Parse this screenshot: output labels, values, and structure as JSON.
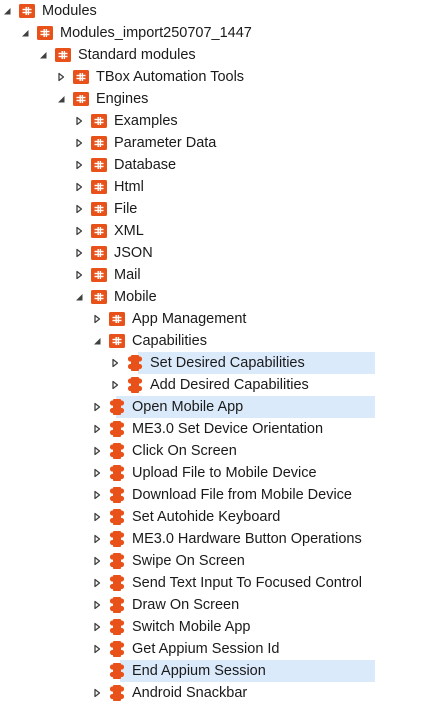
{
  "tree": {
    "root": {
      "label": "Modules",
      "toggle": "expanded",
      "icon": "folder-module-icon"
    },
    "import_folder": {
      "label": "Modules_import250707_1447",
      "toggle": "expanded",
      "icon": "folder-module-icon"
    },
    "standard_modules": {
      "label": "Standard modules",
      "toggle": "expanded",
      "icon": "folder-module-icon"
    },
    "tbox_automation_tools": {
      "label": "TBox Automation Tools",
      "toggle": "collapsed",
      "icon": "folder-module-icon"
    },
    "engines": {
      "label": "Engines",
      "toggle": "expanded",
      "icon": "folder-module-icon"
    },
    "engines_children": [
      {
        "label": "Examples",
        "toggle": "collapsed",
        "icon": "folder-module-icon"
      },
      {
        "label": "Parameter Data",
        "toggle": "collapsed",
        "icon": "folder-module-icon"
      },
      {
        "label": "Database",
        "toggle": "collapsed",
        "icon": "folder-module-icon"
      },
      {
        "label": "Html",
        "toggle": "collapsed",
        "icon": "folder-module-icon"
      },
      {
        "label": "File",
        "toggle": "collapsed",
        "icon": "folder-module-icon"
      },
      {
        "label": "XML",
        "toggle": "collapsed",
        "icon": "folder-module-icon"
      },
      {
        "label": "JSON",
        "toggle": "collapsed",
        "icon": "folder-module-icon"
      },
      {
        "label": "Mail",
        "toggle": "collapsed",
        "icon": "folder-module-icon"
      }
    ],
    "mobile": {
      "label": "Mobile",
      "toggle": "expanded",
      "icon": "folder-module-icon"
    },
    "app_management": {
      "label": "App Management",
      "toggle": "collapsed",
      "icon": "folder-module-icon"
    },
    "capabilities": {
      "label": "Capabilities",
      "toggle": "expanded",
      "icon": "folder-module-icon"
    },
    "capabilities_children": [
      {
        "label": "Set Desired Capabilities",
        "toggle": "collapsed",
        "icon": "puzzle-module-icon",
        "highlighted": true
      },
      {
        "label": "Add Desired Capabilities",
        "toggle": "collapsed",
        "icon": "puzzle-module-icon",
        "highlighted": false
      }
    ],
    "mobile_modules": [
      {
        "label": "Open Mobile App",
        "toggle": "collapsed",
        "icon": "puzzle-module-icon",
        "highlighted": true
      },
      {
        "label": "ME3.0 Set Device Orientation",
        "toggle": "collapsed",
        "icon": "puzzle-module-icon",
        "highlighted": false
      },
      {
        "label": "Click On Screen",
        "toggle": "collapsed",
        "icon": "puzzle-module-icon",
        "highlighted": false
      },
      {
        "label": "Upload File to Mobile Device",
        "toggle": "collapsed",
        "icon": "puzzle-module-icon",
        "highlighted": false
      },
      {
        "label": "Download File from Mobile Device",
        "toggle": "collapsed",
        "icon": "puzzle-module-icon",
        "highlighted": false
      },
      {
        "label": "Set Autohide Keyboard",
        "toggle": "collapsed",
        "icon": "puzzle-module-icon",
        "highlighted": false
      },
      {
        "label": "ME3.0 Hardware Button Operations",
        "toggle": "collapsed",
        "icon": "puzzle-module-icon",
        "highlighted": false
      },
      {
        "label": "Swipe On Screen",
        "toggle": "collapsed",
        "icon": "puzzle-module-icon",
        "highlighted": false
      },
      {
        "label": "Send Text Input To Focused Control",
        "toggle": "collapsed",
        "icon": "puzzle-module-icon",
        "highlighted": false
      },
      {
        "label": "Draw On Screen",
        "toggle": "collapsed",
        "icon": "puzzle-module-icon",
        "highlighted": false
      },
      {
        "label": "Switch Mobile App",
        "toggle": "collapsed",
        "icon": "puzzle-module-icon",
        "highlighted": false
      },
      {
        "label": "Get Appium Session Id",
        "toggle": "collapsed",
        "icon": "puzzle-module-icon",
        "highlighted": false
      },
      {
        "label": "End Appium Session",
        "toggle": "none",
        "icon": "puzzle-module-icon",
        "highlighted": true
      },
      {
        "label": "Android Snackbar",
        "toggle": "collapsed",
        "icon": "puzzle-module-icon",
        "highlighted": false
      }
    ]
  },
  "colors": {
    "icon_orange": "#e8521a",
    "highlight": "#dbeafb",
    "toggle_arrow": "#404040",
    "text": "#1a1a1a"
  }
}
